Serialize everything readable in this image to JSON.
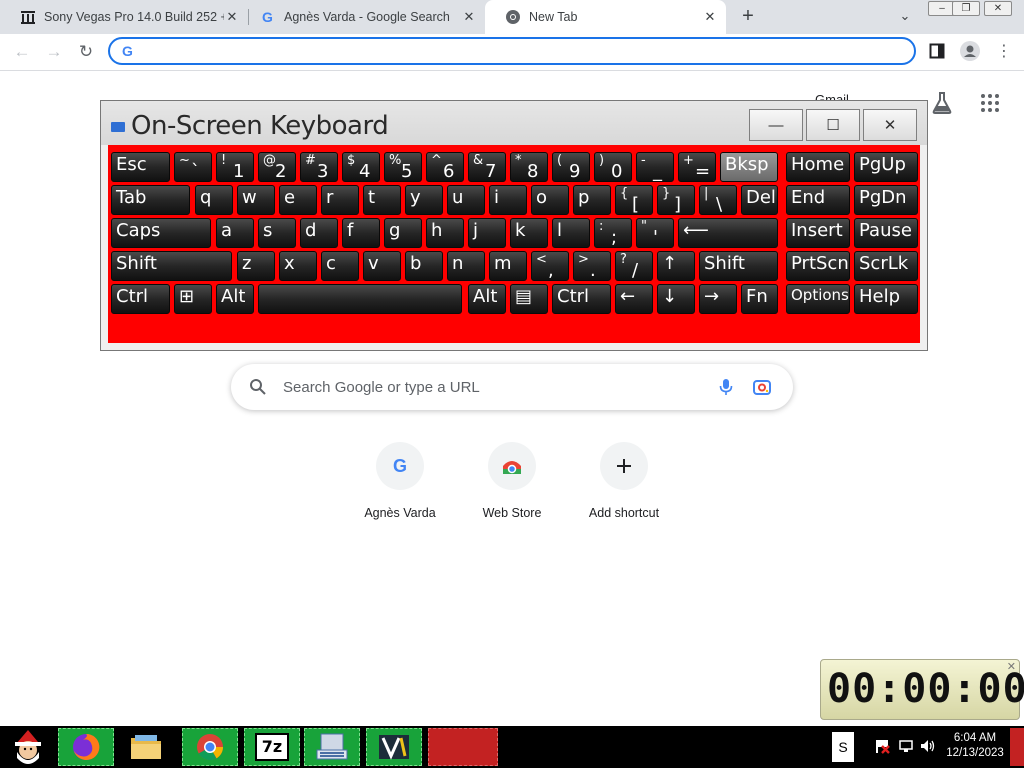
{
  "browser": {
    "tabs": [
      {
        "title": "Sony Vegas Pro 14.0 Build 252 +",
        "icon": "library-icon",
        "active": false
      },
      {
        "title": "Agnès Varda - Google Search",
        "icon": "google-g-icon",
        "active": false
      },
      {
        "title": "New Tab",
        "icon": "chrome-icon",
        "active": true
      }
    ],
    "omnibox_value": "",
    "accent": "#1a73e8"
  },
  "ntp": {
    "gmail_label": "Gmail",
    "search_placeholder": "Search Google or type a URL",
    "shortcuts": [
      {
        "label": "Agnès Varda",
        "icon": "google-g-icon"
      },
      {
        "label": "Web Store",
        "icon": "web-store-icon"
      },
      {
        "label": "Add shortcut",
        "icon": "plus-icon"
      }
    ]
  },
  "osk": {
    "title": "On-Screen Keyboard",
    "background_color": "#ff0000",
    "rows": [
      [
        {
          "id": "esc",
          "label": "Esc"
        },
        {
          "id": "tilde",
          "shift": "~",
          "main": "`"
        },
        {
          "id": "1",
          "shift": "!",
          "main": "1"
        },
        {
          "id": "2",
          "shift": "@",
          "main": "2"
        },
        {
          "id": "3",
          "shift": "#",
          "main": "3"
        },
        {
          "id": "4",
          "shift": "$",
          "main": "4"
        },
        {
          "id": "5",
          "shift": "%",
          "main": "5"
        },
        {
          "id": "6",
          "shift": "^",
          "main": "6"
        },
        {
          "id": "7",
          "shift": "&",
          "main": "7"
        },
        {
          "id": "8",
          "shift": "*",
          "main": "8"
        },
        {
          "id": "9",
          "shift": "(",
          "main": "9"
        },
        {
          "id": "0",
          "shift": ")",
          "main": "0"
        },
        {
          "id": "minus",
          "shift": "-",
          "main": "_"
        },
        {
          "id": "equals",
          "shift": "+",
          "main": "="
        },
        {
          "id": "bksp",
          "label": "Bksp",
          "highlight": true
        },
        {
          "id": "home",
          "label": "Home"
        },
        {
          "id": "pgup",
          "label": "PgUp"
        }
      ],
      [
        {
          "id": "tab",
          "label": "Tab"
        },
        {
          "id": "q",
          "label": "q"
        },
        {
          "id": "w",
          "label": "w"
        },
        {
          "id": "e",
          "label": "e"
        },
        {
          "id": "r",
          "label": "r"
        },
        {
          "id": "t",
          "label": "t"
        },
        {
          "id": "y",
          "label": "y"
        },
        {
          "id": "u",
          "label": "u"
        },
        {
          "id": "i",
          "label": "i"
        },
        {
          "id": "o",
          "label": "o"
        },
        {
          "id": "p",
          "label": "p"
        },
        {
          "id": "lbracket",
          "shift": "{",
          "main": "["
        },
        {
          "id": "rbracket",
          "shift": "}",
          "main": "]"
        },
        {
          "id": "backslash",
          "shift": "|",
          "main": "\\"
        },
        {
          "id": "del",
          "label": "Del"
        },
        {
          "id": "end",
          "label": "End"
        },
        {
          "id": "pgdn",
          "label": "PgDn"
        }
      ],
      [
        {
          "id": "caps",
          "label": "Caps"
        },
        {
          "id": "a",
          "label": "a"
        },
        {
          "id": "s",
          "label": "s"
        },
        {
          "id": "d",
          "label": "d"
        },
        {
          "id": "f",
          "label": "f"
        },
        {
          "id": "g",
          "label": "g"
        },
        {
          "id": "h",
          "label": "h"
        },
        {
          "id": "j",
          "label": "j"
        },
        {
          "id": "k",
          "label": "k"
        },
        {
          "id": "l",
          "label": "l"
        },
        {
          "id": "semicolon",
          "shift": ":",
          "main": ";"
        },
        {
          "id": "quote",
          "shift": "\"",
          "main": "'"
        },
        {
          "id": "enter",
          "label": "⟵"
        },
        {
          "id": "insert",
          "label": "Insert"
        },
        {
          "id": "pause",
          "label": "Pause"
        }
      ],
      [
        {
          "id": "lshift",
          "label": "Shift"
        },
        {
          "id": "z",
          "label": "z"
        },
        {
          "id": "x",
          "label": "x"
        },
        {
          "id": "c",
          "label": "c"
        },
        {
          "id": "v",
          "label": "v"
        },
        {
          "id": "b",
          "label": "b"
        },
        {
          "id": "n",
          "label": "n"
        },
        {
          "id": "m",
          "label": "m"
        },
        {
          "id": "comma",
          "shift": "<",
          "main": ","
        },
        {
          "id": "period",
          "shift": ">",
          "main": "."
        },
        {
          "id": "slash",
          "shift": "?",
          "main": "/"
        },
        {
          "id": "up",
          "label": "↑"
        },
        {
          "id": "rshift",
          "label": "Shift"
        },
        {
          "id": "prtscn",
          "label": "PrtScn"
        },
        {
          "id": "scrlk",
          "label": "ScrLk"
        }
      ],
      [
        {
          "id": "lctrl",
          "label": "Ctrl"
        },
        {
          "id": "win",
          "label": "⊞"
        },
        {
          "id": "lalt",
          "label": "Alt"
        },
        {
          "id": "space",
          "label": ""
        },
        {
          "id": "ralt",
          "label": "Alt"
        },
        {
          "id": "menu",
          "label": "▤"
        },
        {
          "id": "rctrl",
          "label": "Ctrl"
        },
        {
          "id": "left",
          "label": "←"
        },
        {
          "id": "down",
          "label": "↓"
        },
        {
          "id": "right",
          "label": "→"
        },
        {
          "id": "fn",
          "label": "Fn"
        },
        {
          "id": "options",
          "label": "Options"
        },
        {
          "id": "help",
          "label": "Help"
        }
      ]
    ]
  },
  "timer": {
    "display": "00:00:00"
  },
  "taskbar": {
    "items": [
      {
        "name": "start-santa-icon"
      },
      {
        "name": "firefox-icon"
      },
      {
        "name": "file-explorer-icon"
      },
      {
        "name": "chrome-icon"
      },
      {
        "name": "7zip-icon",
        "label": "7z"
      },
      {
        "name": "on-screen-keyboard-icon"
      },
      {
        "name": "video-editor-icon"
      },
      {
        "name": "red-app-icon"
      }
    ],
    "tray_letter": "S",
    "clock_time": "6:04 AM",
    "clock_date": "12/13/2023"
  }
}
